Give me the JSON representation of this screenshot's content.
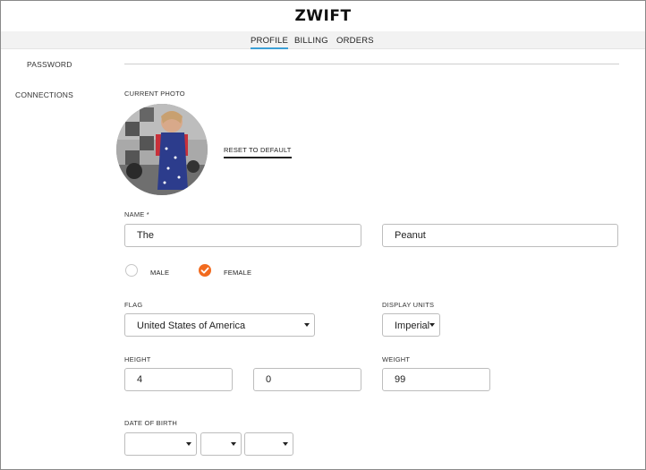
{
  "brand": {
    "logo": "ZWIFT"
  },
  "tabs": [
    {
      "label": "PROFILE",
      "active": true
    },
    {
      "label": "BILLING",
      "active": false
    },
    {
      "label": "ORDERS",
      "active": false
    }
  ],
  "sidebar": {
    "items": [
      {
        "label": "PASSWORD"
      },
      {
        "label": "CONNECTIONS"
      }
    ]
  },
  "profile": {
    "photo_label": "CURRENT PHOTO",
    "reset_label": "RESET TO DEFAULT",
    "name_label": "NAME *",
    "first_name": "The",
    "last_name": "Peanut",
    "gender": {
      "male_label": "MALE",
      "female_label": "FEMALE",
      "selected": "FEMALE"
    },
    "flag_label": "FLAG",
    "flag_value": "United States of America",
    "units_label": "DISPLAY UNITS",
    "units_value": "Imperial",
    "height_label": "HEIGHT",
    "height_feet": "4",
    "height_inches": "0",
    "weight_label": "WEIGHT",
    "weight_value": "99",
    "dob_label": "DATE OF BIRTH"
  },
  "colors": {
    "accent": "#f26b1f",
    "tab_underline": "#3ca0d6"
  }
}
